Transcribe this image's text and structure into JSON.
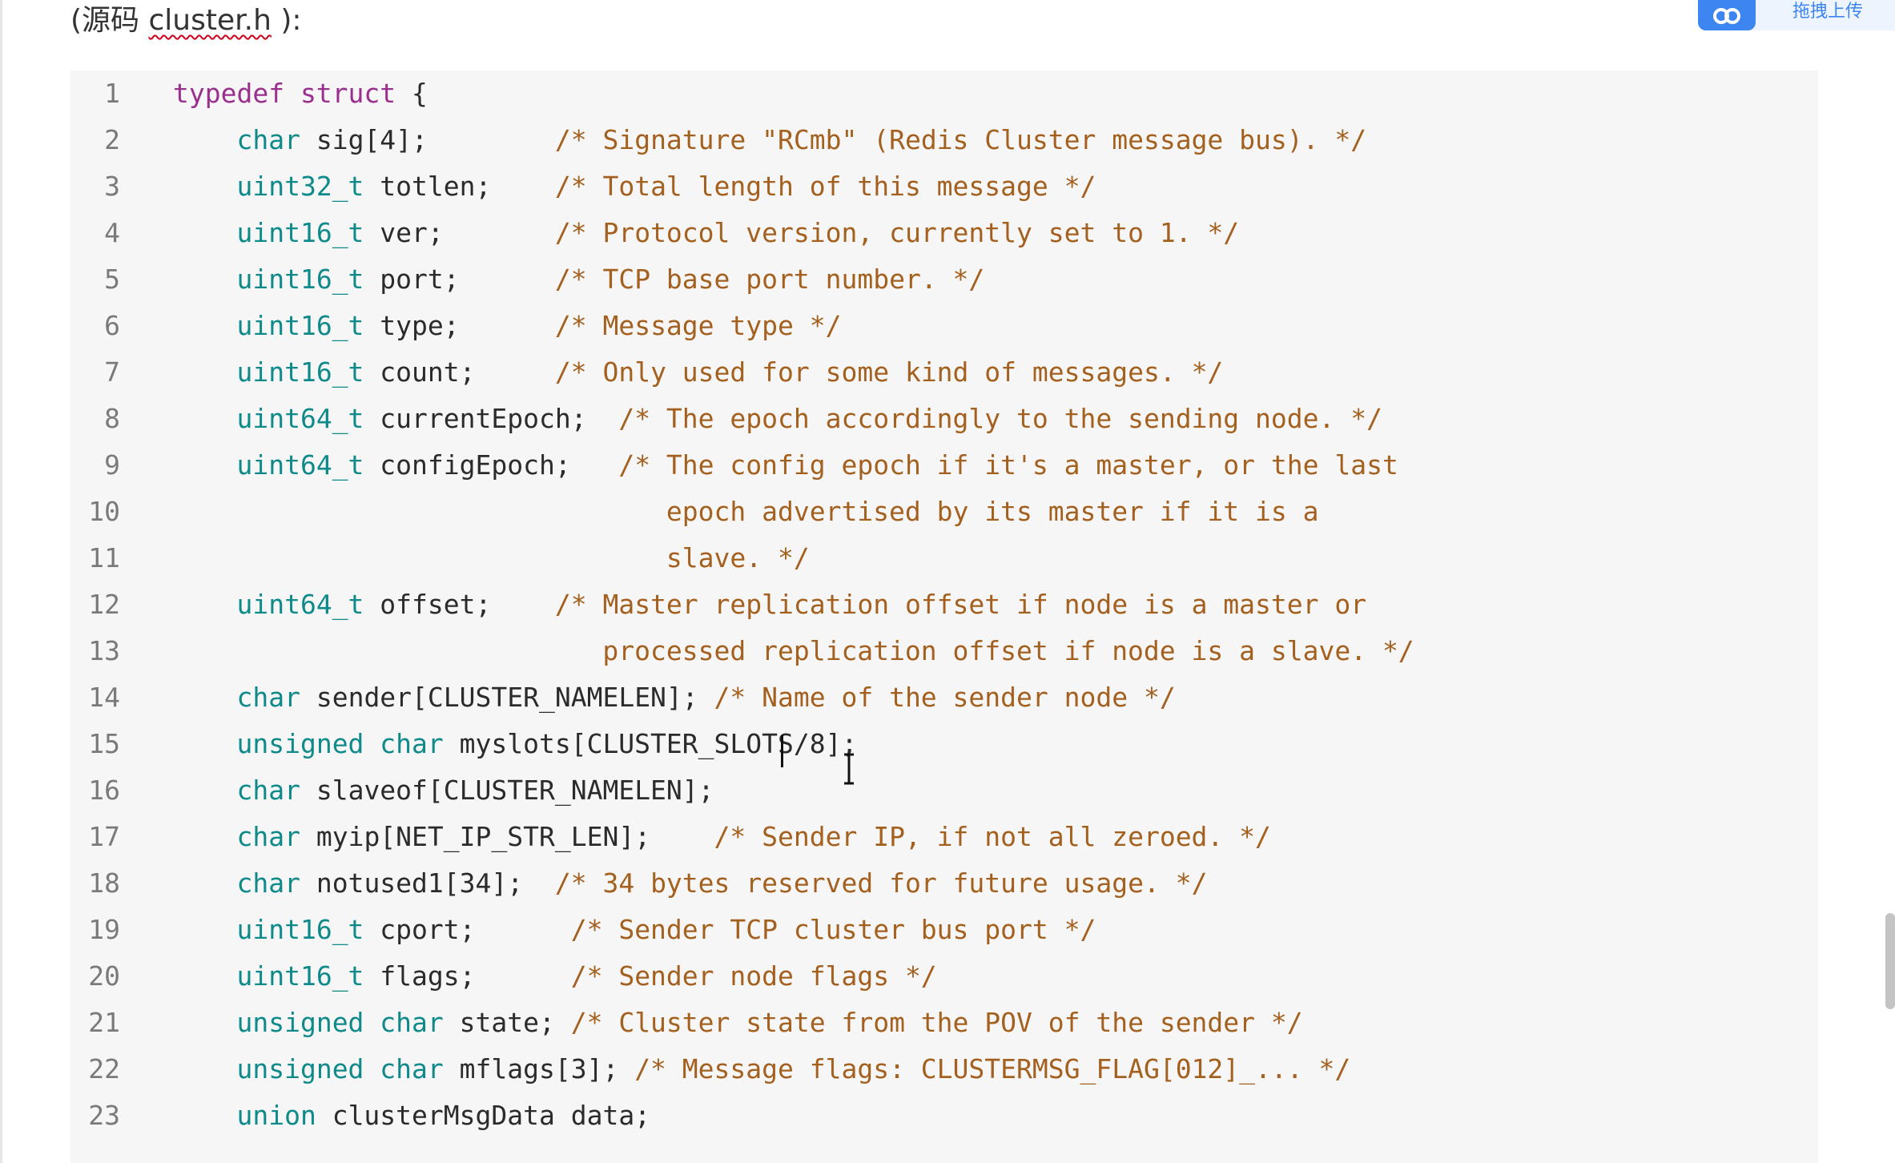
{
  "caption": {
    "open": "(源码 ",
    "filename": "cluster.h",
    "close": " ):"
  },
  "upload_widget": {
    "icon": "cloud-upload-icon",
    "label": "拖拽上传"
  },
  "colors": {
    "keyword": "#9b2f8e",
    "type": "#0f8a8a",
    "comment": "#a4601e",
    "line_number": "#7a7a7a",
    "background": "#f6f6f6"
  },
  "code_lines": [
    {
      "n": "1",
      "tokens": [
        {
          "t": "kw",
          "v": "typedef struct"
        },
        {
          "t": "nm",
          "v": " {"
        }
      ]
    },
    {
      "n": "2",
      "tokens": [
        {
          "t": "nm",
          "v": "    "
        },
        {
          "t": "ty",
          "v": "char"
        },
        {
          "t": "nm",
          "v": " sig[4];        "
        },
        {
          "t": "cm",
          "v": "/* Signature \"RCmb\" (Redis Cluster message bus). */"
        }
      ]
    },
    {
      "n": "3",
      "tokens": [
        {
          "t": "nm",
          "v": "    "
        },
        {
          "t": "ty",
          "v": "uint32_t"
        },
        {
          "t": "nm",
          "v": " totlen;    "
        },
        {
          "t": "cm",
          "v": "/* Total length of this message */"
        }
      ]
    },
    {
      "n": "4",
      "tokens": [
        {
          "t": "nm",
          "v": "    "
        },
        {
          "t": "ty",
          "v": "uint16_t"
        },
        {
          "t": "nm",
          "v": " ver;       "
        },
        {
          "t": "cm",
          "v": "/* Protocol version, currently set to 1. */"
        }
      ]
    },
    {
      "n": "5",
      "tokens": [
        {
          "t": "nm",
          "v": "    "
        },
        {
          "t": "ty",
          "v": "uint16_t"
        },
        {
          "t": "nm",
          "v": " port;      "
        },
        {
          "t": "cm",
          "v": "/* TCP base port number. */"
        }
      ]
    },
    {
      "n": "6",
      "tokens": [
        {
          "t": "nm",
          "v": "    "
        },
        {
          "t": "ty",
          "v": "uint16_t"
        },
        {
          "t": "nm",
          "v": " type;      "
        },
        {
          "t": "cm",
          "v": "/* Message type */"
        }
      ]
    },
    {
      "n": "7",
      "tokens": [
        {
          "t": "nm",
          "v": "    "
        },
        {
          "t": "ty",
          "v": "uint16_t"
        },
        {
          "t": "nm",
          "v": " count;     "
        },
        {
          "t": "cm",
          "v": "/* Only used for some kind of messages. */"
        }
      ]
    },
    {
      "n": "8",
      "tokens": [
        {
          "t": "nm",
          "v": "    "
        },
        {
          "t": "ty",
          "v": "uint64_t"
        },
        {
          "t": "nm",
          "v": " currentEpoch;  "
        },
        {
          "t": "cm",
          "v": "/* The epoch accordingly to the sending node. */"
        }
      ]
    },
    {
      "n": "9",
      "tokens": [
        {
          "t": "nm",
          "v": "    "
        },
        {
          "t": "ty",
          "v": "uint64_t"
        },
        {
          "t": "nm",
          "v": " configEpoch;   "
        },
        {
          "t": "cm",
          "v": "/* The config epoch if it's a master, or the last"
        }
      ]
    },
    {
      "n": "10",
      "tokens": [
        {
          "t": "cm",
          "v": "                               epoch advertised by its master if it is a"
        }
      ]
    },
    {
      "n": "11",
      "tokens": [
        {
          "t": "cm",
          "v": "                               slave. */"
        }
      ]
    },
    {
      "n": "12",
      "tokens": [
        {
          "t": "nm",
          "v": "    "
        },
        {
          "t": "ty",
          "v": "uint64_t"
        },
        {
          "t": "nm",
          "v": " offset;    "
        },
        {
          "t": "cm",
          "v": "/* Master replication offset if node is a master or"
        }
      ]
    },
    {
      "n": "13",
      "tokens": [
        {
          "t": "cm",
          "v": "                           processed replication offset if node is a slave. */"
        }
      ]
    },
    {
      "n": "14",
      "tokens": [
        {
          "t": "nm",
          "v": "    "
        },
        {
          "t": "ty",
          "v": "char"
        },
        {
          "t": "nm",
          "v": " sender[CLUSTER_NAMELEN]; "
        },
        {
          "t": "cm",
          "v": "/* Name of the sender node */"
        }
      ]
    },
    {
      "n": "15",
      "tokens": [
        {
          "t": "nm",
          "v": "    "
        },
        {
          "t": "ty",
          "v": "unsigned char"
        },
        {
          "t": "nm",
          "v": " myslots[CLUSTER_SLOTS/8];"
        }
      ]
    },
    {
      "n": "16",
      "tokens": [
        {
          "t": "nm",
          "v": "    "
        },
        {
          "t": "ty",
          "v": "char"
        },
        {
          "t": "nm",
          "v": " slaveof[CLUSTER_NAMELEN];"
        }
      ]
    },
    {
      "n": "17",
      "tokens": [
        {
          "t": "nm",
          "v": "    "
        },
        {
          "t": "ty",
          "v": "char"
        },
        {
          "t": "nm",
          "v": " myip[NET_IP_STR_LEN];    "
        },
        {
          "t": "cm",
          "v": "/* Sender IP, if not all zeroed. */"
        }
      ]
    },
    {
      "n": "18",
      "tokens": [
        {
          "t": "nm",
          "v": "    "
        },
        {
          "t": "ty",
          "v": "char"
        },
        {
          "t": "nm",
          "v": " notused1[34];  "
        },
        {
          "t": "cm",
          "v": "/* 34 bytes reserved for future usage. */"
        }
      ]
    },
    {
      "n": "19",
      "tokens": [
        {
          "t": "nm",
          "v": "    "
        },
        {
          "t": "ty",
          "v": "uint16_t"
        },
        {
          "t": "nm",
          "v": " cport;      "
        },
        {
          "t": "cm",
          "v": "/* Sender TCP cluster bus port */"
        }
      ]
    },
    {
      "n": "20",
      "tokens": [
        {
          "t": "nm",
          "v": "    "
        },
        {
          "t": "ty",
          "v": "uint16_t"
        },
        {
          "t": "nm",
          "v": " flags;      "
        },
        {
          "t": "cm",
          "v": "/* Sender node flags */"
        }
      ]
    },
    {
      "n": "21",
      "tokens": [
        {
          "t": "nm",
          "v": "    "
        },
        {
          "t": "ty",
          "v": "unsigned char"
        },
        {
          "t": "nm",
          "v": " state; "
        },
        {
          "t": "cm",
          "v": "/* Cluster state from the POV of the sender */"
        }
      ]
    },
    {
      "n": "22",
      "tokens": [
        {
          "t": "nm",
          "v": "    "
        },
        {
          "t": "ty",
          "v": "unsigned char"
        },
        {
          "t": "nm",
          "v": " mflags[3]; "
        },
        {
          "t": "cm",
          "v": "/* Message flags: CLUSTERMSG_FLAG[012]_... */"
        }
      ]
    },
    {
      "n": "23",
      "tokens": [
        {
          "t": "nm",
          "v": "    "
        },
        {
          "t": "ty",
          "v": "union"
        },
        {
          "t": "nm",
          "v": " clusterMsgData data;"
        }
      ]
    }
  ]
}
